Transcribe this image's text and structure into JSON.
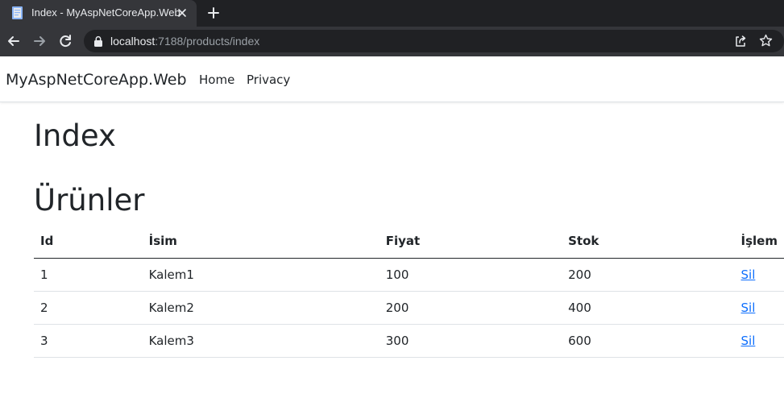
{
  "browser": {
    "tab_title": "Index - MyAspNetCoreApp.Web",
    "url_host": "localhost",
    "url_rest": ":7188/products/index"
  },
  "navbar": {
    "brand": "MyAspNetCoreApp.Web",
    "links": [
      "Home",
      "Privacy"
    ]
  },
  "page": {
    "title": "Index",
    "heading": "Ürünler"
  },
  "table": {
    "headers": [
      "Id",
      "İsim",
      "Fiyat",
      "Stok",
      "İşlem"
    ],
    "rows": [
      {
        "id": "1",
        "name": "Kalem1",
        "price": "100",
        "stock": "200",
        "action": "Sil"
      },
      {
        "id": "2",
        "name": "Kalem2",
        "price": "200",
        "stock": "400",
        "action": "Sil"
      },
      {
        "id": "3",
        "name": "Kalem3",
        "price": "300",
        "stock": "600",
        "action": "Sil"
      }
    ]
  },
  "colors": {
    "chrome_dark": "#202124",
    "chrome_tab": "#35363a",
    "link": "#0d6efd",
    "text": "#212529"
  }
}
